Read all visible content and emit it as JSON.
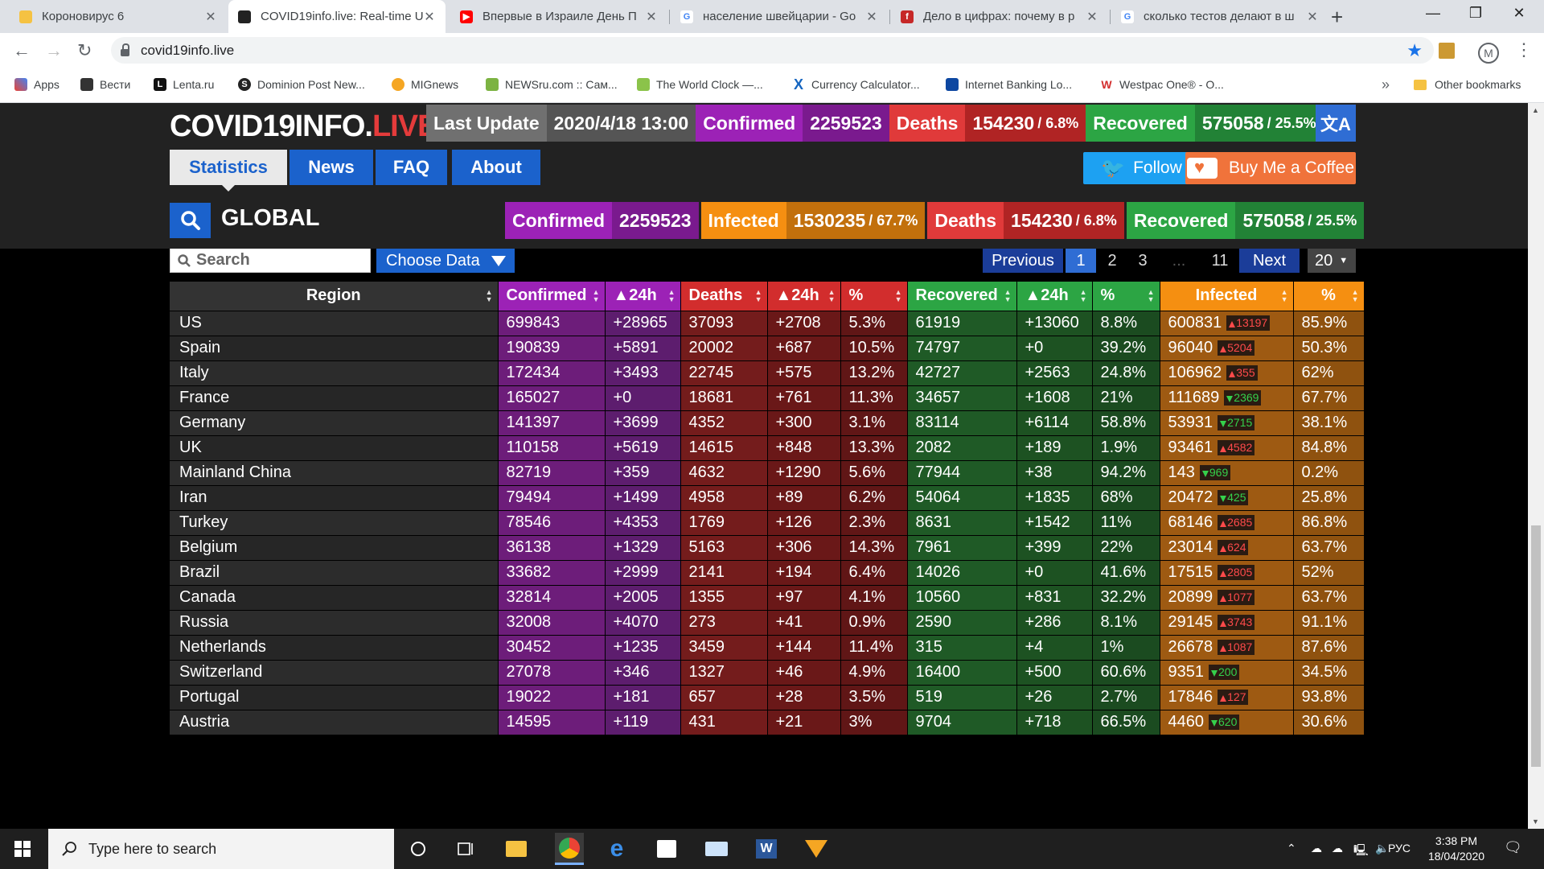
{
  "browser": {
    "tabs": [
      {
        "title": "Коронови­рус 6",
        "icon_color": "#f5c242"
      },
      {
        "title": "COVID19info.live: Real-time U",
        "icon_color": "#222222"
      },
      {
        "title": "Впервые в Израиле День П",
        "icon_color": "#ff0000"
      },
      {
        "title": "население швейцарии - Go",
        "icon_color": "#4285f4"
      },
      {
        "title": "Дело в цифрах: почему в р",
        "icon_color": "#c62828"
      },
      {
        "title": "сколько тестов делают в ш",
        "icon_color": "#4285f4"
      }
    ],
    "new_tab": "+",
    "url": "covid19info.live",
    "bookmarks": [
      {
        "label": "Apps",
        "icon_color": "#4285f4"
      },
      {
        "label": "Вести",
        "icon_color": "#333333"
      },
      {
        "label": "Lenta.ru",
        "icon_color": "#111111"
      },
      {
        "label": "Dominion Post New...",
        "icon_color": "#222222"
      },
      {
        "label": "MIGnews",
        "icon_color": "#f5a623"
      },
      {
        "label": "NEWSru.com :: Сам...",
        "icon_color": "#7cb342"
      },
      {
        "label": "The World Clock —...",
        "icon_color": "#8bc34a"
      },
      {
        "label": "Currency Calculator...",
        "icon_color": "#1565c0"
      },
      {
        "label": "Internet Banking Lo...",
        "icon_color": "#0d47a1"
      },
      {
        "label": "Westpac One® - O...",
        "icon_color": "#d32f2f"
      }
    ],
    "bookmarks_more": "»",
    "other_bookmarks": "Other bookmarks",
    "avatar_letter": "M"
  },
  "site": {
    "logo_main": "COVID19INFO.",
    "logo_accent": "LIVE",
    "last_update_label": "Last Update",
    "last_update_value": "2020/4/18 13:00",
    "top_stats": {
      "confirmed_label": "Confirmed",
      "confirmed_value": "2259523",
      "deaths_label": "Deaths",
      "deaths_value": "154230",
      "deaths_pct": "/ 6.8%",
      "recovered_label": "Recovered",
      "recovered_value": "575058",
      "recovered_pct": "/ 25.5%"
    },
    "translate_icon": "文A",
    "nav": [
      "Statistics",
      "News",
      "FAQ",
      "About"
    ],
    "follow_label": "Follow",
    "coffee_label": "Buy Me a Coffee",
    "global_label": "GLOBAL",
    "global_stats": {
      "confirmed_label": "Confirmed",
      "confirmed_value": "2259523",
      "infected_label": "Infected",
      "infected_value": "1530235",
      "infected_pct": "/ 67.7%",
      "deaths_label": "Deaths",
      "deaths_value": "154230",
      "deaths_pct": "/ 6.8%",
      "recovered_label": "Recovered",
      "recovered_value": "575058",
      "recovered_pct": "/ 25.5%"
    },
    "search_placeholder": "Search",
    "choose_data": "Choose Data",
    "pagination": {
      "previous": "Previous",
      "pages": [
        "1",
        "2",
        "3"
      ],
      "ellipsis": "...",
      "last": "11",
      "next": "Next",
      "current": "1"
    },
    "per_page": "20",
    "colors": {
      "confirmed": "#9c22b6",
      "deaths": "#d22d2d",
      "recovered": "#2ca544",
      "infected": "#f58f11",
      "accent": "#1b62cc"
    }
  },
  "table": {
    "headers": [
      "Region",
      "Confirmed",
      "▲24h",
      "Deaths",
      "▲24h",
      "%",
      "Recovered",
      "▲24h",
      "%",
      "Infected",
      "%"
    ],
    "rows": [
      {
        "region": "US",
        "confirmed": "699843",
        "conf24": "+28965",
        "deaths": "37093",
        "death24": "+2708",
        "dpct": "5.3%",
        "recovered": "61919",
        "rec24": "+13060",
        "rpct": "8.8%",
        "infected": "600831",
        "inf_change": "13197",
        "inf_dir": "up",
        "ipct": "85.9%"
      },
      {
        "region": "Spain",
        "confirmed": "190839",
        "conf24": "+5891",
        "deaths": "20002",
        "death24": "+687",
        "dpct": "10.5%",
        "recovered": "74797",
        "rec24": "+0",
        "rpct": "39.2%",
        "infected": "96040",
        "inf_change": "5204",
        "inf_dir": "up",
        "ipct": "50.3%"
      },
      {
        "region": "Italy",
        "confirmed": "172434",
        "conf24": "+3493",
        "deaths": "22745",
        "death24": "+575",
        "dpct": "13.2%",
        "recovered": "42727",
        "rec24": "+2563",
        "rpct": "24.8%",
        "infected": "106962",
        "inf_change": "355",
        "inf_dir": "up",
        "ipct": "62%"
      },
      {
        "region": "France",
        "confirmed": "165027",
        "conf24": "+0",
        "deaths": "18681",
        "death24": "+761",
        "dpct": "11.3%",
        "recovered": "34657",
        "rec24": "+1608",
        "rpct": "21%",
        "infected": "111689",
        "inf_change": "2369",
        "inf_dir": "down",
        "ipct": "67.7%"
      },
      {
        "region": "Germany",
        "confirmed": "141397",
        "conf24": "+3699",
        "deaths": "4352",
        "death24": "+300",
        "dpct": "3.1%",
        "recovered": "83114",
        "rec24": "+6114",
        "rpct": "58.8%",
        "infected": "53931",
        "inf_change": "2715",
        "inf_dir": "down",
        "ipct": "38.1%"
      },
      {
        "region": "UK",
        "confirmed": "110158",
        "conf24": "+5619",
        "deaths": "14615",
        "death24": "+848",
        "dpct": "13.3%",
        "recovered": "2082",
        "rec24": "+189",
        "rpct": "1.9%",
        "infected": "93461",
        "inf_change": "4582",
        "inf_dir": "up",
        "ipct": "84.8%"
      },
      {
        "region": "Mainland China",
        "confirmed": "82719",
        "conf24": "+359",
        "deaths": "4632",
        "death24": "+1290",
        "dpct": "5.6%",
        "recovered": "77944",
        "rec24": "+38",
        "rpct": "94.2%",
        "infected": "143",
        "inf_change": "969",
        "inf_dir": "down",
        "ipct": "0.2%"
      },
      {
        "region": "Iran",
        "confirmed": "79494",
        "conf24": "+1499",
        "deaths": "4958",
        "death24": "+89",
        "dpct": "6.2%",
        "recovered": "54064",
        "rec24": "+1835",
        "rpct": "68%",
        "infected": "20472",
        "inf_change": "425",
        "inf_dir": "down",
        "ipct": "25.8%"
      },
      {
        "region": "Turkey",
        "confirmed": "78546",
        "conf24": "+4353",
        "deaths": "1769",
        "death24": "+126",
        "dpct": "2.3%",
        "recovered": "8631",
        "rec24": "+1542",
        "rpct": "11%",
        "infected": "68146",
        "inf_change": "2685",
        "inf_dir": "up",
        "ipct": "86.8%"
      },
      {
        "region": "Belgium",
        "confirmed": "36138",
        "conf24": "+1329",
        "deaths": "5163",
        "death24": "+306",
        "dpct": "14.3%",
        "recovered": "7961",
        "rec24": "+399",
        "rpct": "22%",
        "infected": "23014",
        "inf_change": "624",
        "inf_dir": "up",
        "ipct": "63.7%"
      },
      {
        "region": "Brazil",
        "confirmed": "33682",
        "conf24": "+2999",
        "deaths": "2141",
        "death24": "+194",
        "dpct": "6.4%",
        "recovered": "14026",
        "rec24": "+0",
        "rpct": "41.6%",
        "infected": "17515",
        "inf_change": "2805",
        "inf_dir": "up",
        "ipct": "52%"
      },
      {
        "region": "Canada",
        "confirmed": "32814",
        "conf24": "+2005",
        "deaths": "1355",
        "death24": "+97",
        "dpct": "4.1%",
        "recovered": "10560",
        "rec24": "+831",
        "rpct": "32.2%",
        "infected": "20899",
        "inf_change": "1077",
        "inf_dir": "up",
        "ipct": "63.7%"
      },
      {
        "region": "Russia",
        "confirmed": "32008",
        "conf24": "+4070",
        "deaths": "273",
        "death24": "+41",
        "dpct": "0.9%",
        "recovered": "2590",
        "rec24": "+286",
        "rpct": "8.1%",
        "infected": "29145",
        "inf_change": "3743",
        "inf_dir": "up",
        "ipct": "91.1%"
      },
      {
        "region": "Netherlands",
        "confirmed": "30452",
        "conf24": "+1235",
        "deaths": "3459",
        "death24": "+144",
        "dpct": "11.4%",
        "recovered": "315",
        "rec24": "+4",
        "rpct": "1%",
        "infected": "26678",
        "inf_change": "1087",
        "inf_dir": "up",
        "ipct": "87.6%"
      },
      {
        "region": "Switzerland",
        "confirmed": "27078",
        "conf24": "+346",
        "deaths": "1327",
        "death24": "+46",
        "dpct": "4.9%",
        "recovered": "16400",
        "rec24": "+500",
        "rpct": "60.6%",
        "infected": "9351",
        "inf_change": "200",
        "inf_dir": "down",
        "ipct": "34.5%"
      },
      {
        "region": "Portugal",
        "confirmed": "19022",
        "conf24": "+181",
        "deaths": "657",
        "death24": "+28",
        "dpct": "3.5%",
        "recovered": "519",
        "rec24": "+26",
        "rpct": "2.7%",
        "infected": "17846",
        "inf_change": "127",
        "inf_dir": "up",
        "ipct": "93.8%"
      },
      {
        "region": "Austria",
        "confirmed": "14595",
        "conf24": "+119",
        "deaths": "431",
        "death24": "+21",
        "dpct": "3%",
        "recovered": "9704",
        "rec24": "+718",
        "rpct": "66.5%",
        "infected": "4460",
        "inf_change": "620",
        "inf_dir": "down",
        "ipct": "30.6%"
      }
    ]
  },
  "taskbar": {
    "search_placeholder": "Type here to search",
    "lang": "РУС",
    "time": "3:38 PM",
    "date": "18/04/2020"
  }
}
